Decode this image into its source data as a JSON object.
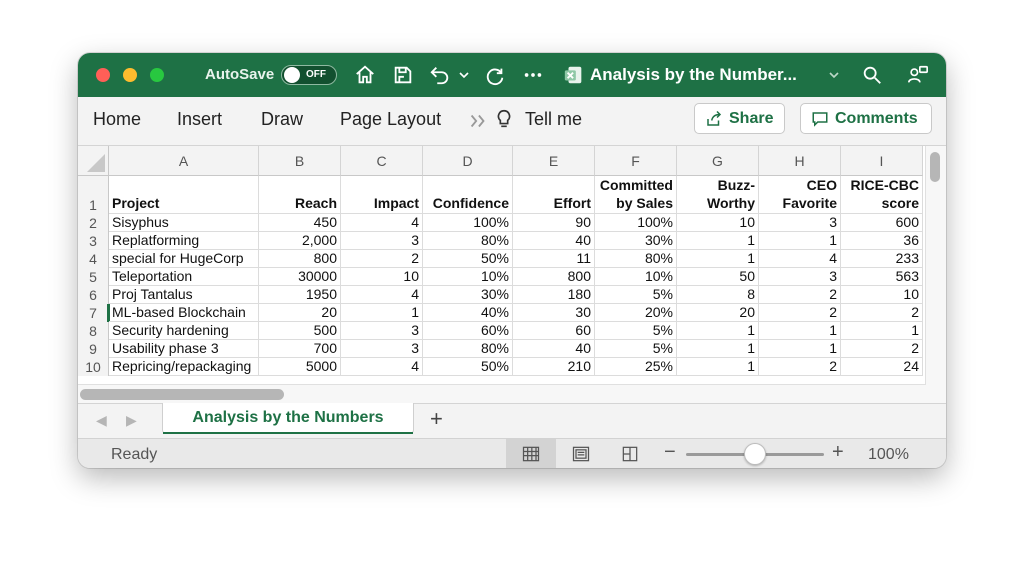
{
  "titlebar": {
    "autosave_label": "AutoSave",
    "autosave_state": "OFF",
    "doc_title": "Analysis by the Number..."
  },
  "ribbon": {
    "menu": [
      "Home",
      "Insert",
      "Draw",
      "Page Layout",
      "Tell me"
    ],
    "share_label": "Share",
    "comments_label": "Comments"
  },
  "grid": {
    "columns": [
      "A",
      "B",
      "C",
      "D",
      "E",
      "F",
      "G",
      "H",
      "I"
    ],
    "header_row": {
      "row_number": "1",
      "cells": [
        "Project",
        "Reach",
        "Impact",
        "Confidence",
        "Effort",
        "Committed by Sales",
        "Buzz-Worthy",
        "CEO Favorite",
        "RICE-CBC score"
      ]
    },
    "rows": [
      {
        "row_number": "2",
        "cells": [
          "Sisyphus",
          "450",
          "4",
          "100%",
          "90",
          "100%",
          "10",
          "3",
          "600"
        ]
      },
      {
        "row_number": "3",
        "cells": [
          "Replatforming",
          "2,000",
          "3",
          "80%",
          "40",
          "30%",
          "1",
          "1",
          "36"
        ]
      },
      {
        "row_number": "4",
        "cells": [
          "special for HugeCorp",
          "800",
          "2",
          "50%",
          "11",
          "80%",
          "1",
          "4",
          "233"
        ]
      },
      {
        "row_number": "5",
        "cells": [
          "Teleportation",
          "30000",
          "10",
          "10%",
          "800",
          "10%",
          "50",
          "3",
          "563"
        ]
      },
      {
        "row_number": "6",
        "cells": [
          "Proj Tantalus",
          "1950",
          "4",
          "30%",
          "180",
          "5%",
          "8",
          "2",
          "10"
        ]
      },
      {
        "row_number": "7",
        "cells": [
          "ML-based Blockchain",
          "20",
          "1",
          "40%",
          "30",
          "20%",
          "20",
          "2",
          "2"
        ]
      },
      {
        "row_number": "8",
        "cells": [
          "Security hardening",
          "500",
          "3",
          "60%",
          "60",
          "5%",
          "1",
          "1",
          "1"
        ]
      },
      {
        "row_number": "9",
        "cells": [
          "Usability phase 3",
          "700",
          "3",
          "80%",
          "40",
          "5%",
          "1",
          "1",
          "2"
        ]
      },
      {
        "row_number": "10",
        "cells": [
          "Repricing/repackaging",
          "5000",
          "4",
          "50%",
          "210",
          "25%",
          "1",
          "2",
          "24"
        ]
      }
    ],
    "selected_row": "7"
  },
  "sheet_tabs": {
    "active": "Analysis by the Numbers",
    "add_label": "+"
  },
  "statusbar": {
    "status": "Ready",
    "zoom_level": "100%",
    "zoom_minus": "−",
    "zoom_plus": "+"
  },
  "colors": {
    "brand": "#1e7145",
    "close": "#ff5f57",
    "minimize": "#febc2e",
    "zoom": "#28c840"
  }
}
